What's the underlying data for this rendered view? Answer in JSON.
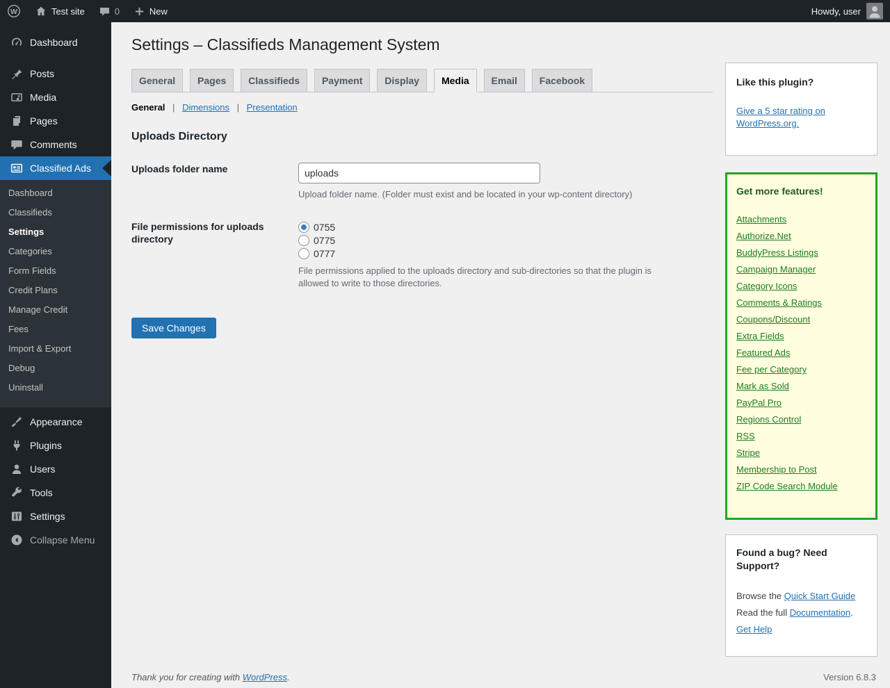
{
  "admin_bar": {
    "site_name": "Test site",
    "comments_count": "0",
    "new_label": "New",
    "howdy": "Howdy, user"
  },
  "sidebar": {
    "items": [
      {
        "label": "Dashboard"
      },
      {
        "label": "Posts"
      },
      {
        "label": "Media"
      },
      {
        "label": "Pages"
      },
      {
        "label": "Comments"
      },
      {
        "label": "Classified Ads"
      },
      {
        "label": "Appearance"
      },
      {
        "label": "Plugins"
      },
      {
        "label": "Users"
      },
      {
        "label": "Tools"
      },
      {
        "label": "Settings"
      }
    ],
    "submenu": [
      "Dashboard",
      "Classifieds",
      "Settings",
      "Categories",
      "Form Fields",
      "Credit Plans",
      "Manage Credit",
      "Fees",
      "Import & Export",
      "Debug",
      "Uninstall"
    ],
    "submenu_current": "Settings",
    "collapse": "Collapse Menu"
  },
  "page": {
    "title": "Settings – Classifieds Management System",
    "tabs": [
      "General",
      "Pages",
      "Classifieds",
      "Payment",
      "Display",
      "Media",
      "Email",
      "Facebook"
    ],
    "active_tab": "Media",
    "subnav": {
      "current": "General",
      "separator": "|",
      "links": [
        "Dimensions",
        "Presentation"
      ]
    },
    "section_title": "Uploads Directory",
    "fields": {
      "folder": {
        "label": "Uploads folder name",
        "value": "uploads",
        "help": "Upload folder name. (Folder must exist and be located in your wp-content directory)"
      },
      "permissions": {
        "label": "File permissions for uploads directory",
        "options": [
          "0755",
          "0775",
          "0777"
        ],
        "selected": "0755",
        "help": "File permissions applied to the uploads directory and sub-directories so that the plugin is allowed to write to those directories."
      }
    },
    "save_button": "Save Changes"
  },
  "aside": {
    "like_box": {
      "title": "Like this plugin?",
      "link": "Give a 5 star rating on WordPress.org."
    },
    "features_box": {
      "title": "Get more features!",
      "links": [
        "Attachments",
        "Authorize.Net",
        "BuddyPress Listings",
        "Campaign Manager",
        "Category Icons",
        "Comments & Ratings",
        "Coupons/Discount",
        "Extra Fields",
        "Featured Ads",
        "Fee per Category",
        "Mark as Sold",
        "PayPal Pro",
        "Regions Control",
        "RSS",
        "Stripe",
        "Membership to Post",
        "ZIP Code Search Module"
      ]
    },
    "support_box": {
      "title": "Found a bug? Need Support?",
      "line1_prefix": "Browse the ",
      "line1_link": "Quick Start Guide",
      "line2_prefix": "Read the full ",
      "line2_link": "Documentation",
      "line2_suffix": ".",
      "line3_link": "Get Help"
    }
  },
  "footer": {
    "thanks_prefix": "Thank you for creating with ",
    "thanks_link": "WordPress",
    "thanks_suffix": ".",
    "version": "Version 6.8.3"
  },
  "colors": {
    "accent": "#2271b1",
    "admin_bar_bg": "#1d2327",
    "submenu_bg": "#2c3338",
    "body_bg": "#f0f0f1",
    "features_border": "#22a322",
    "features_bg": "#ffffe0",
    "features_link": "#1e7b1e",
    "radio_checked": "#3582c4"
  }
}
